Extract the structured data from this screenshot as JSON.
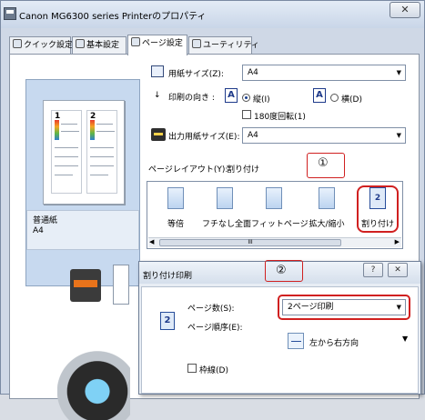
{
  "window": {
    "title": "Canon MG6300 series Printerのプロパティ",
    "close_label": "✕"
  },
  "tabs": [
    {
      "label": "クイック設定",
      "active": false
    },
    {
      "label": "基本設定",
      "active": false
    },
    {
      "label": "ページ設定",
      "active": true
    },
    {
      "label": "ユーティリティ",
      "active": false
    }
  ],
  "preview": {
    "paper_type": "普通紙",
    "paper_size": "A4",
    "page_numbers": [
      "1",
      "2"
    ]
  },
  "page_setup": {
    "paper_size_label": "用紙サイズ(Z):",
    "paper_size_value": "A4",
    "orientation_label": "印刷の向き :",
    "portrait_label": "縦(I)",
    "landscape_label": "横(D)",
    "orientation_selected": "portrait",
    "rotate_label": "180度回転(1)",
    "rotate_checked": false,
    "output_size_label": "出力用紙サイズ(E):",
    "output_size_value": "A4",
    "layout_label": "ページレイアウト(Y):",
    "layout_value": "割り付け",
    "marker_1": "①",
    "layout_options": [
      {
        "label": "等倍",
        "selected": false
      },
      {
        "label": "フチなし全面",
        "selected": false
      },
      {
        "label": "フィットページ",
        "selected": false
      },
      {
        "label": "拡大/縮小",
        "selected": false
      },
      {
        "label": "割り付け",
        "selected": true,
        "icon_text": "2"
      }
    ],
    "scroll_thumb_text": "III"
  },
  "dialog": {
    "title": "割り付け印刷",
    "marker_2": "②",
    "help_label": "?",
    "close_label": "✕",
    "icon_text": "2",
    "pages_label": "ページ数(S):",
    "pages_value": "2ページ印刷",
    "order_label": "ページ順序(E):",
    "order_value": "左から右方向",
    "border_label": "枠線(D)",
    "border_checked": false
  },
  "colors": {
    "highlight_red": "#d02020",
    "accent_blue": "#1e3a8a"
  }
}
